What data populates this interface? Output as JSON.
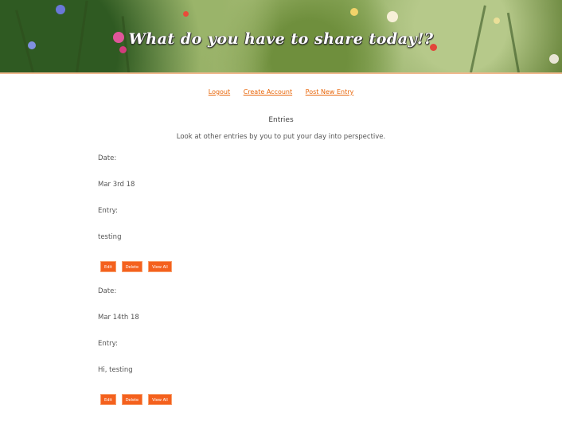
{
  "header": {
    "title": "What do you have to share today!?"
  },
  "nav": {
    "logout": "Logout",
    "create_account": "Create Account",
    "post_new_entry": "Post New Entry"
  },
  "entries_section": {
    "title": "Entries",
    "subtitle": "Look at other entries by you to put your day into perspective."
  },
  "entries": [
    {
      "date_label": "Date:",
      "date": "Mar 3rd 18",
      "entry_label": "Entry:",
      "text": "testing",
      "buttons": {
        "edit": "Edit",
        "delete": "Delete",
        "view_all": "View All"
      }
    },
    {
      "date_label": "Date:",
      "date": "Mar 14th 18",
      "entry_label": "Entry:",
      "text": "Hi, testing",
      "buttons": {
        "edit": "Edit",
        "delete": "Delete",
        "view_all": "View All"
      }
    }
  ],
  "colors": {
    "accent": "#f4611e",
    "link": "#e8660a",
    "banner_rule": "#f0b98f"
  }
}
